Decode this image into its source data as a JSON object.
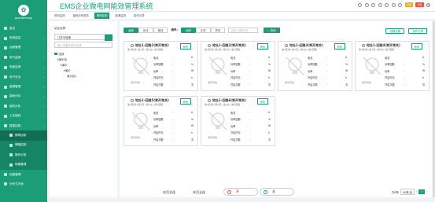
{
  "sidebar": {
    "logo_text": "guardenergy",
    "items": [
      {
        "label": "首页"
      },
      {
        "label": "系统监控",
        "arrow": "‹"
      },
      {
        "label": "运维管理",
        "arrow": "‹"
      },
      {
        "label": "电气监测",
        "arrow": "‹"
      },
      {
        "label": "电能监测",
        "arrow": "‹"
      },
      {
        "label": "电气安全",
        "arrow": "‹"
      },
      {
        "label": "能源管理",
        "arrow": "‹"
      },
      {
        "label": "能耗分析",
        "arrow": "‹"
      },
      {
        "label": "能效分析",
        "arrow": "‹"
      },
      {
        "label": "工业能耗",
        "arrow": "‹"
      },
      {
        "label": "智能控制",
        "arrow": "⌄"
      },
      {
        "label": "照明控制",
        "sub": true,
        "active": true
      },
      {
        "label": "策略控制",
        "sub": true
      },
      {
        "label": "操作记录",
        "sub": true
      },
      {
        "label": "场景管理",
        "sub": true
      },
      {
        "label": "设备管理",
        "arrow": "‹"
      },
      {
        "label": "分布式光伏",
        "arrow": "‹"
      }
    ]
  },
  "header": {
    "title": "EMS企业微电网能效管理系统",
    "badge1": "运营",
    "badge2": "监控"
  },
  "tabs": [
    {
      "label": "首页监测"
    },
    {
      "label": "能耗分析报告"
    },
    {
      "label": "照明控制",
      "active": true
    },
    {
      "label": "能源监测"
    },
    {
      "label": "操作记录"
    }
  ],
  "panel": {
    "title": "站点名称",
    "site_value": "江苏中能港",
    "search_placeholder": "输入关键字进行过滤",
    "tree": [
      {
        "label": "全部"
      },
      {
        "label": "演示站"
      },
      {
        "label": "演示"
      },
      {
        "label": "演示"
      },
      {
        "label": "演示站1"
      }
    ]
  },
  "filter": {
    "group1": [
      "全部",
      "在线",
      "离线"
    ],
    "group1_active": 0,
    "label": "通讯:",
    "group2": [
      "全部",
      "正常",
      "异常"
    ],
    "group2_active": 0,
    "search_placeholder": "请输入回路名称",
    "query": "查询",
    "btn_right1": "回路设置",
    "btn_right2": "操作记录"
  },
  "cards": [
    {
      "name": "地址1-回路1(常开常关)",
      "sub": "第1区域>第1区>第1台>第1回路",
      "status": "通讯异常",
      "edit": "修改",
      "rows": [
        {
          "k": "电流",
          "v": "-",
          "u": "A"
        },
        {
          "k": "功率因数",
          "v": "-",
          "u": "%"
        },
        {
          "k": "功率",
          "v": "-",
          "u": "W"
        },
        {
          "k": "开启时长",
          "v": "-",
          "u": "h"
        },
        {
          "k": "开启次数",
          "v": "-",
          "u": "次"
        }
      ]
    },
    {
      "name": "地址1-回路2(常开常关)",
      "sub": "第1区域>第1区>第1台>第2回路",
      "status": "通讯异常",
      "edit": "修改",
      "rows": [
        {
          "k": "电流",
          "v": "-",
          "u": "A"
        },
        {
          "k": "功率因数",
          "v": "-",
          "u": "%"
        },
        {
          "k": "功率",
          "v": "-",
          "u": "W"
        },
        {
          "k": "开启时长",
          "v": "-",
          "u": "h"
        },
        {
          "k": "开启次数",
          "v": "-",
          "u": "次"
        }
      ]
    },
    {
      "name": "地址1-回路3(常开常关)",
      "sub": "第1区域>第1区>第1台>第3回路",
      "status": "通讯异常",
      "edit": "修改",
      "rows": [
        {
          "k": "电流",
          "v": "-",
          "u": "A"
        },
        {
          "k": "功率因数",
          "v": "-",
          "u": "%"
        },
        {
          "k": "功率",
          "v": "-",
          "u": "W"
        },
        {
          "k": "开启时长",
          "v": "-",
          "u": "h"
        },
        {
          "k": "开启次数",
          "v": "-",
          "u": "次"
        }
      ]
    },
    {
      "name": "地址1-回路4(常开常关)",
      "sub": "第1区域>第1区>第1台>第4回路",
      "status": "通讯异常",
      "edit": "修改",
      "rows": [
        {
          "k": "电流",
          "v": "-",
          "u": "A"
        },
        {
          "k": "功率因数",
          "v": "-",
          "u": "%"
        },
        {
          "k": "功率",
          "v": "-",
          "u": "W"
        },
        {
          "k": "开启时长",
          "v": "-",
          "u": "h"
        },
        {
          "k": "开启次数",
          "v": "-",
          "u": "次"
        }
      ]
    },
    {
      "name": "地址1-回路5(常开常关)",
      "sub": "第1区域>第1区>第1台>第5回路",
      "status": "通讯异常",
      "edit": "修改",
      "rows": [
        {
          "k": "电流",
          "v": "-",
          "u": "A"
        },
        {
          "k": "功率因数",
          "v": "-",
          "u": "%"
        },
        {
          "k": "功率",
          "v": "-",
          "u": "W"
        },
        {
          "k": "开启时长",
          "v": "-",
          "u": "h"
        },
        {
          "k": "开启次数",
          "v": "-",
          "u": "次"
        }
      ]
    },
    {
      "name": "地址1-回路6(常开常关)",
      "sub": "第1区域>第1区>第1台>第6回路",
      "status": "通讯异常",
      "edit": "修改",
      "rows": [
        {
          "k": "电流",
          "v": "-",
          "u": "A"
        },
        {
          "k": "功率因数",
          "v": "-",
          "u": "%"
        },
        {
          "k": "功率",
          "v": "-",
          "u": "W"
        },
        {
          "k": "开启时长",
          "v": "-",
          "u": "h"
        },
        {
          "k": "开启次数",
          "v": "-",
          "u": "次"
        }
      ]
    }
  ],
  "bottom": {
    "select_page": "本页全选",
    "cancel_page": "本页全选",
    "on": "开",
    "off": "关",
    "total": "共6条",
    "page_size": "40条/页",
    "page": "1"
  },
  "colors": {
    "accent": "#1b9e77"
  }
}
